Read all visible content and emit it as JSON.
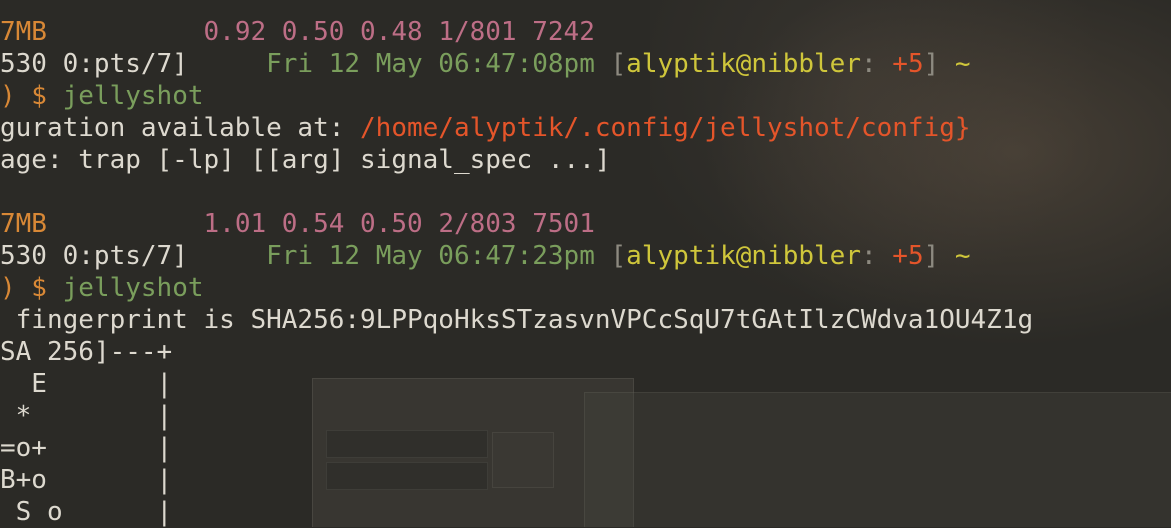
{
  "terminal": {
    "block1": {
      "mem": "7MB",
      "loadavg": "0.92 0.50 0.48 1/801 7242",
      "session": "530 0:pts/7]",
      "datetime": "Fri 12 May 06:47:08pm",
      "user_host": "alyptik@nibbler",
      "jobs": "+5",
      "cwd": "~",
      "prompt_tail": ") $",
      "command": "jellyshot",
      "output_config_prefix": "guration available at:",
      "output_config_path": "/home/alyptik/.config/jellyshot/config}",
      "output_trap": "age: trap [-lp] [[arg] signal_spec ...]"
    },
    "block2": {
      "mem": "7MB",
      "loadavg": "1.01 0.54 0.50 2/803 7501",
      "session": "530 0:pts/7]",
      "datetime": "Fri 12 May 06:47:23pm",
      "user_host": "alyptik@nibbler",
      "jobs": "+5",
      "cwd": "~",
      "prompt_tail": ") $",
      "command": "jellyshot",
      "fingerprint": " fingerprint is SHA256:9LPPqoHksSTzasvnVPCcSqU7tGAtIlzCWdva1OU4Z1g",
      "randomart": [
        "SA 256]---+",
        "  E       |",
        " *        |",
        "=o+       |",
        "B+o       |",
        " S o      |"
      ]
    },
    "punct": {
      "open_bracket": "[",
      "close_bracket": "]",
      "colon": ":"
    },
    "colors": {
      "orange": "#d88836",
      "pink": "#bd6e86",
      "green": "#7a9e5c",
      "yellow": "#cfc63b",
      "red": "#e4552a",
      "grey": "#8d8a80",
      "text": "#ddd9cf"
    }
  }
}
